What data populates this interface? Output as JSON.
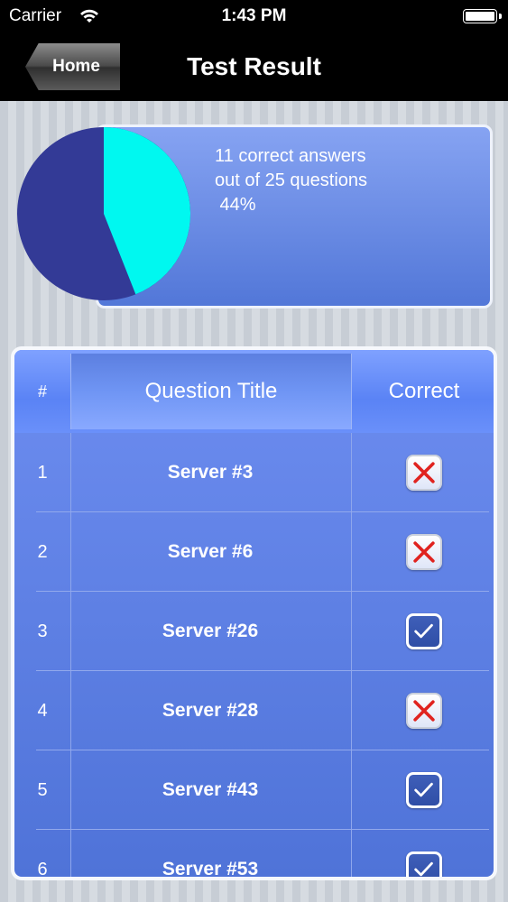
{
  "status_bar": {
    "carrier": "Carrier",
    "time": "1:43 PM",
    "wifi_icon": "wifi-icon",
    "battery_icon": "battery-icon"
  },
  "nav": {
    "back_label": "Home",
    "title": "Test Result"
  },
  "summary": {
    "line1": "11 correct answers",
    "line2": "out of 25 questions",
    "line3": " 44%",
    "correct": 11,
    "total": 25,
    "percent": 44
  },
  "pie_colors": {
    "correct": "#00f8f0",
    "incorrect": "#333a96"
  },
  "table": {
    "headers": {
      "num": "#",
      "title": "Question Title",
      "correct": "Correct"
    },
    "rows": [
      {
        "num": "1",
        "title": "Server #3",
        "correct": false
      },
      {
        "num": "2",
        "title": "Server #6",
        "correct": false
      },
      {
        "num": "3",
        "title": "Server #26",
        "correct": true
      },
      {
        "num": "4",
        "title": "Server #28",
        "correct": false
      },
      {
        "num": "5",
        "title": "Server #43",
        "correct": true
      },
      {
        "num": "6",
        "title": "Server #53",
        "correct": true
      }
    ]
  }
}
